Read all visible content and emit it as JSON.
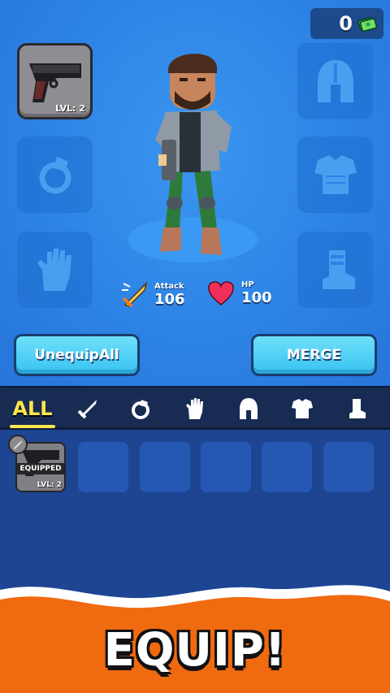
{
  "currency": {
    "amount": "0",
    "icon": "cash-icon"
  },
  "weapon_slot": {
    "level": "LVL: 2",
    "icon": "pistol-icon"
  },
  "gear_slots": [
    "helmet-icon",
    "ring-icon",
    "armor-icon",
    "glove-icon",
    "boot-icon"
  ],
  "stats": {
    "attack_label": "Attack",
    "attack_value": "106",
    "hp_label": "HP",
    "hp_value": "100"
  },
  "buttons": {
    "unequip_all": "UnequipAll",
    "merge": "MERGE"
  },
  "tabs": {
    "all": "ALL",
    "icons": [
      "sword-icon",
      "ring-icon",
      "glove-icon",
      "helmet-icon",
      "armor-icon",
      "boot-icon"
    ]
  },
  "inventory": {
    "equipped_label": "EQUIPPED",
    "item_level": "LVL: 2",
    "empty_slots": 5
  },
  "banner": {
    "title": "EQUIP!"
  },
  "colors": {
    "accent": "#3bc4f1",
    "tab_active": "#ffe84a",
    "banner": "#f06a10"
  }
}
